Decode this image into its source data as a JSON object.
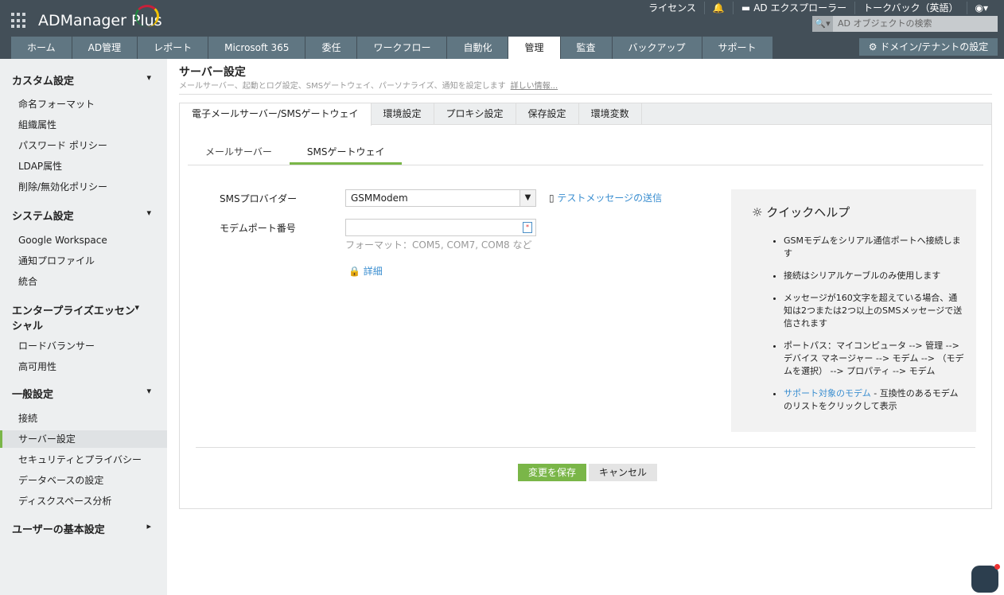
{
  "app": {
    "title": "ADManager Plus"
  },
  "toplinks": {
    "license": "ライセンス",
    "explorer": "AD エクスプローラー",
    "talkback": "トークバック（英語）"
  },
  "search": {
    "placeholder": "AD オブジェクトの検索"
  },
  "nav": [
    "ホーム",
    "AD管理",
    "レポート",
    "Microsoft 365",
    "委任",
    "ワークフロー",
    "自動化",
    "管理",
    "監査",
    "バックアップ",
    "サポート"
  ],
  "domain_button": "ドメイン/テナントの設定",
  "sidebar": {
    "sections": [
      "カスタム設定",
      "システム設定",
      "エンタープライズエッセンシャル",
      "一般設定",
      "ユーザーの基本設定"
    ],
    "items": [
      "命名フォーマット",
      "組織属性",
      "パスワード ポリシー",
      "LDAP属性",
      "削除/無効化ポリシー",
      "Google Workspace",
      "通知プロファイル",
      "統合",
      "ロードバランサー",
      "高可用性",
      "接続",
      "サーバー設定",
      "セキュリティとプライバシー",
      "データベースの設定",
      "ディスクスペース分析"
    ]
  },
  "page": {
    "title": "サーバー設定",
    "subtitle": "メールサーバー、起動とログ設定、SMSゲートウェイ、パーソナライズ、通知を設定します",
    "more": "詳しい情報..."
  },
  "tabs": [
    "電子メールサーバー/SMSゲートウェイ",
    "環境設定",
    "プロキシ設定",
    "保存設定",
    "環境変数"
  ],
  "subtabs": [
    "メールサーバー",
    "SMSゲートウェイ"
  ],
  "form": {
    "provider_label": "SMSプロバイダー",
    "provider_value": "GSMModem",
    "test_link": "テストメッセージの送信",
    "port_label": "モデムポート番号",
    "port_value": "",
    "port_hint": "フォーマット：COM5, COM7, COM8 など",
    "advanced": "詳細"
  },
  "help": {
    "title": "クイックヘルプ",
    "items": [
      "GSMモデムをシリアル通信ポートへ接続します",
      "接続はシリアルケーブルのみ使用します",
      "メッセージが160文字を超えている場合、通知は2つまたは2つ以上のSMSメッセージで送信されます",
      "ポートパス：マイコンピュータ --> 管理 --> デバイス マネージャー --> モデム --> （モデムを選択） --> プロパティ --> モデム"
    ],
    "link": "サポート対象のモデム",
    "link_suffix": " - 互換性のあるモデムのリストをクリックして表示"
  },
  "buttons": {
    "save": "変更を保存",
    "cancel": "キャンセル"
  }
}
